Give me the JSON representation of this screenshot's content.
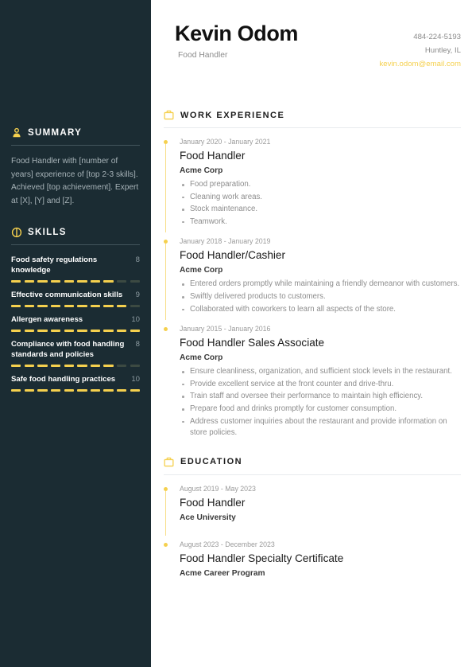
{
  "header": {
    "full_name": "Kevin Odom",
    "job_title": "Food Handler",
    "phone": "484-224-5193",
    "location": "Huntley, IL",
    "email": "kevin.odom@email.com"
  },
  "colors": {
    "sidebar_bg": "#1b2c33",
    "accent_yellow": "#f5d04e",
    "muted_text": "#8d8d8d",
    "dark_text": "#1a1a1a"
  },
  "sidebar": {
    "summary": {
      "icon": "person-icon",
      "title": "SUMMARY",
      "text": "Food Handler with [number of years] experience of [top 2-3 skills]. Achieved [top achievement]. Expert at [X], [Y] and [Z]."
    },
    "skills": {
      "icon": "skills-circle-icon",
      "title": "SKILLS",
      "max_rating": 10,
      "items": [
        {
          "name": "Food safety regulations knowledge",
          "rating": 8
        },
        {
          "name": "Effective communication skills",
          "rating": 9
        },
        {
          "name": "Allergen awareness",
          "rating": 10
        },
        {
          "name": "Compliance with food handling standards and policies",
          "rating": 8
        },
        {
          "name": "Safe food handling practices",
          "rating": 10
        }
      ]
    }
  },
  "main": {
    "work_experience": {
      "icon": "briefcase-icon",
      "title": "WORK EXPERIENCE",
      "items": [
        {
          "date": "January 2020 - January 2021",
          "role": "Food Handler",
          "org": "Acme Corp",
          "bullets": [
            "Food preparation.",
            "Cleaning work areas.",
            "Stock maintenance.",
            "Teamwork."
          ]
        },
        {
          "date": "January 2018 - January 2019",
          "role": "Food Handler/Cashier",
          "org": "Acme Corp",
          "bullets": [
            "Entered orders promptly while maintaining a friendly demeanor with customers.",
            "Swiftly delivered products to customers.",
            "Collaborated with coworkers to learn all aspects of the store."
          ]
        },
        {
          "date": "January 2015 - January 2016",
          "role": "Food Handler Sales Associate",
          "org": "Acme Corp",
          "bullets": [
            "Ensure cleanliness, organization, and sufficient stock levels in the restaurant.",
            "Provide excellent service at the front counter and drive-thru.",
            "Train staff and oversee their performance to maintain high efficiency.",
            "Prepare food and drinks promptly for customer consumption.",
            "Address customer inquiries about the restaurant and provide information on store policies."
          ]
        }
      ]
    },
    "education": {
      "icon": "briefcase-icon",
      "title": "EDUCATION",
      "items": [
        {
          "date": "August 2019 - May 2023",
          "role": "Food Handler",
          "org": "Ace University"
        },
        {
          "date": "August 2023 - December 2023",
          "role": "Food Handler Specialty Certificate",
          "org": "Acme Career Program"
        }
      ]
    }
  }
}
